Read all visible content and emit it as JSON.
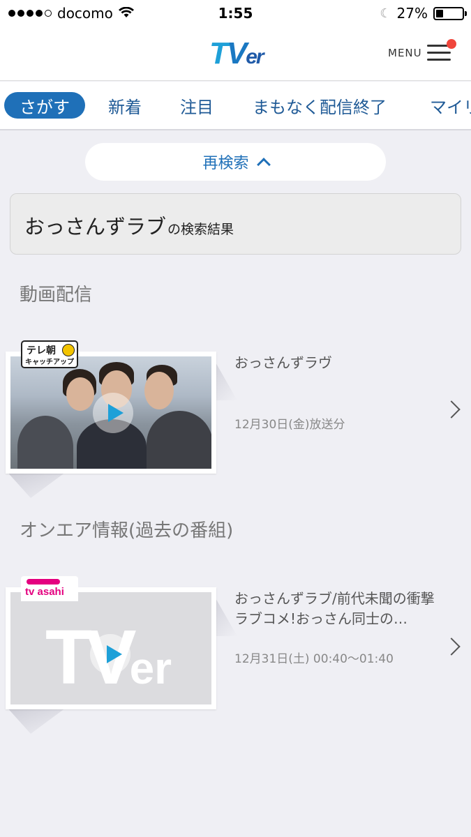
{
  "status_bar": {
    "carrier": "docomo",
    "time": "1:55",
    "battery_percent": "27%",
    "battery_level": 0.27,
    "signal_bars_filled": 4,
    "signal_bars_total": 5
  },
  "header": {
    "logo_t": "T",
    "logo_v": "V",
    "logo_er": "er",
    "menu_label": "MENU",
    "has_notification": true
  },
  "tabs": [
    {
      "label": "さがす",
      "active": true
    },
    {
      "label": "新着",
      "active": false
    },
    {
      "label": "注目",
      "active": false
    },
    {
      "label": "まもなく配信終了",
      "active": false
    },
    {
      "label": "マイリ",
      "active": false
    }
  ],
  "search": {
    "research_label": "再検索",
    "query": "おっさんずラブ",
    "result_suffix": "の検索結果"
  },
  "sections": {
    "video_title": "動画配信",
    "onair_title": "オンエア情報(過去の番組)"
  },
  "video_item": {
    "badge_line1": "テレ朝",
    "badge_line2": "キャッチアップ",
    "title": "おっさんずラヴ",
    "date": "12月30日(金)放送分"
  },
  "onair_item": {
    "badge": "tv asahi",
    "placeholder_big": "TV",
    "placeholder_small": "er",
    "title": "おっさんずラブ/前代未聞の衝撃ラブコメ!おっさん同士の…",
    "date": "12月31日(土) 00:40〜01:40"
  },
  "colors": {
    "accent": "#1f70b8",
    "tab_text": "#1f5a96",
    "notification": "#f0463c",
    "background": "#efeff4",
    "tv_asahi_pink": "#e4007f"
  },
  "icons": [
    "wifi-icon",
    "moon-icon",
    "battery-icon",
    "hamburger-menu-icon",
    "chevron-up-icon",
    "play-icon",
    "chevron-right-icon"
  ]
}
